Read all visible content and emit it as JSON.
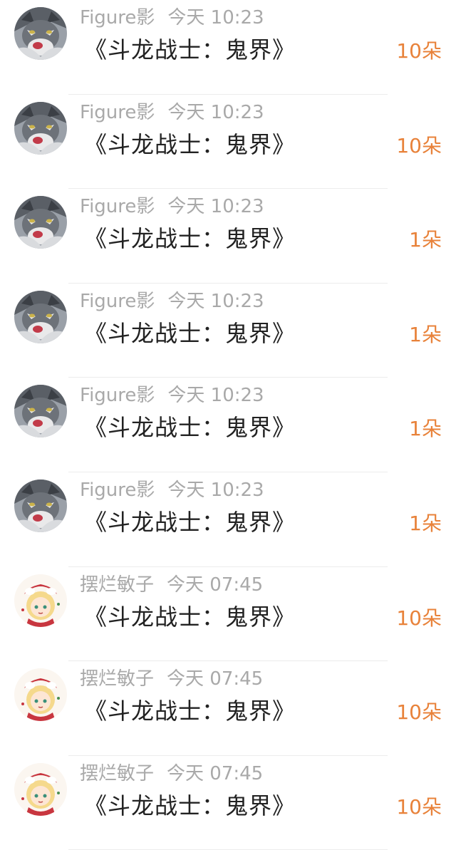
{
  "colors": {
    "meta_text": "#a9a9a9",
    "title_text": "#222222",
    "amount_text": "#e8823a"
  },
  "gifts": [
    {
      "user": "Figure影",
      "time": "今天 10:23",
      "title": "《斗龙战士：鬼界》",
      "amount": "10朵",
      "avatar": "cat-avatar-icon"
    },
    {
      "user": "Figure影",
      "time": "今天 10:23",
      "title": "《斗龙战士：鬼界》",
      "amount": "10朵",
      "avatar": "cat-avatar-icon"
    },
    {
      "user": "Figure影",
      "time": "今天 10:23",
      "title": "《斗龙战士：鬼界》",
      "amount": "1朵",
      "avatar": "cat-avatar-icon"
    },
    {
      "user": "Figure影",
      "time": "今天 10:23",
      "title": "《斗龙战士：鬼界》",
      "amount": "1朵",
      "avatar": "cat-avatar-icon"
    },
    {
      "user": "Figure影",
      "time": "今天 10:23",
      "title": "《斗龙战士：鬼界》",
      "amount": "1朵",
      "avatar": "cat-avatar-icon"
    },
    {
      "user": "Figure影",
      "time": "今天 10:23",
      "title": "《斗龙战士：鬼界》",
      "amount": "1朵",
      "avatar": "cat-avatar-icon"
    },
    {
      "user": "摆烂敏子",
      "time": "今天 07:45",
      "title": "《斗龙战士：鬼界》",
      "amount": "10朵",
      "avatar": "anime-girl-avatar-icon"
    },
    {
      "user": "摆烂敏子",
      "time": "今天 07:45",
      "title": "《斗龙战士：鬼界》",
      "amount": "10朵",
      "avatar": "anime-girl-avatar-icon"
    },
    {
      "user": "摆烂敏子",
      "time": "今天 07:45",
      "title": "《斗龙战士：鬼界》",
      "amount": "10朵",
      "avatar": "anime-girl-avatar-icon"
    }
  ]
}
